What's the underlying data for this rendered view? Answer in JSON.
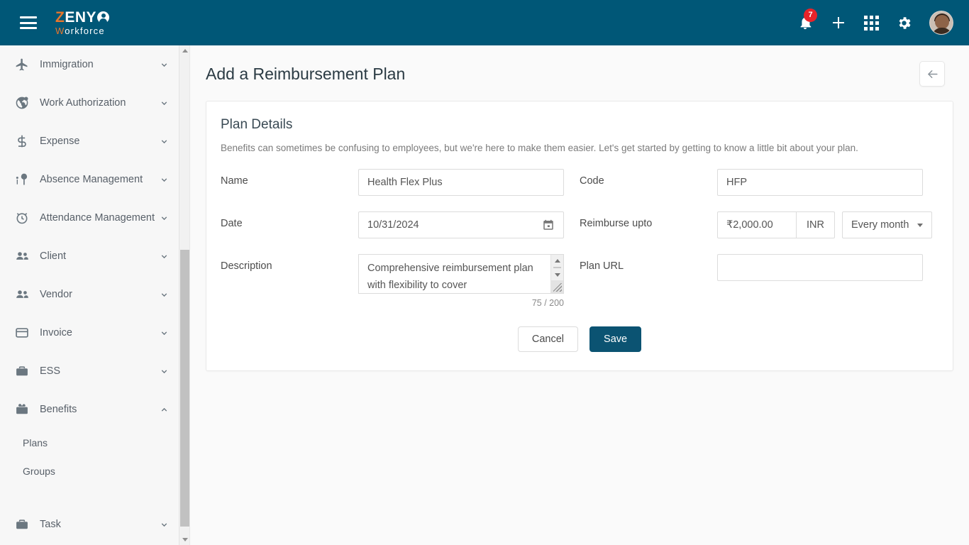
{
  "brand": {
    "name_part1": "Z",
    "name_part2": "ENY",
    "name_part3": "O",
    "sub_part1": "W",
    "sub_part2": "orkforce"
  },
  "topbar": {
    "menu_icon": "hamburger-icon",
    "notification_icon": "bell-icon",
    "notification_count": "7",
    "add_icon": "plus-icon",
    "apps_icon": "grid-apps-icon",
    "settings_icon": "gear-icon",
    "avatar_icon": "user-avatar"
  },
  "sidebar": {
    "items": [
      {
        "label": "Immigration",
        "icon": "airplane-icon",
        "state": "collapsed"
      },
      {
        "label": "Work Authorization",
        "icon": "globe-check-icon",
        "state": "collapsed"
      },
      {
        "label": "Expense",
        "icon": "dollar-icon",
        "state": "collapsed"
      },
      {
        "label": "Absence Management",
        "icon": "person-tree-icon",
        "state": "collapsed"
      },
      {
        "label": "Attendance Management",
        "icon": "alarm-clock-icon",
        "state": "collapsed"
      },
      {
        "label": "Client",
        "icon": "people-icon",
        "state": "collapsed"
      },
      {
        "label": "Vendor",
        "icon": "people-icon",
        "state": "collapsed"
      },
      {
        "label": "Invoice",
        "icon": "card-icon",
        "state": "collapsed"
      },
      {
        "label": "ESS",
        "icon": "briefcase-icon",
        "state": "collapsed"
      },
      {
        "label": "Benefits",
        "icon": "benefits-box-icon",
        "state": "expanded"
      }
    ],
    "benefits_children": [
      {
        "label": "Plans"
      },
      {
        "label": "Groups"
      }
    ],
    "last_item": {
      "label": "Task",
      "icon": "briefcase-icon",
      "state": "collapsed"
    }
  },
  "page": {
    "title": "Add a Reimbursement Plan",
    "back_icon": "arrow-left-icon"
  },
  "card": {
    "title": "Plan Details",
    "subtitle": "Benefits can sometimes be confusing to employees, but we're here to make them easier. Let's get started by getting to know a little bit about your plan."
  },
  "fields": {
    "name": {
      "label": "Name",
      "value": "Health Flex Plus",
      "placeholder": ""
    },
    "code": {
      "label": "Code",
      "value": "HFP",
      "placeholder": ""
    },
    "date": {
      "label": "Date",
      "value": "10/31/2024",
      "icon": "calendar-icon"
    },
    "reimburse": {
      "label": "Reimburse upto",
      "amount": "₹2,000.00",
      "currency": "INR",
      "frequency": "Every month"
    },
    "description": {
      "label": "Description",
      "value": "Comprehensive reimbursement plan with flexibility to cover",
      "counter": "75 / 200"
    },
    "plan_url": {
      "label": "Plan URL",
      "value": "",
      "placeholder": ""
    }
  },
  "buttons": {
    "cancel": "Cancel",
    "save": "Save"
  },
  "colors": {
    "brand_teal": "#005777",
    "save_button": "#0b5372",
    "accent_orange": "#e8762c",
    "badge_red": "#e8232a"
  }
}
